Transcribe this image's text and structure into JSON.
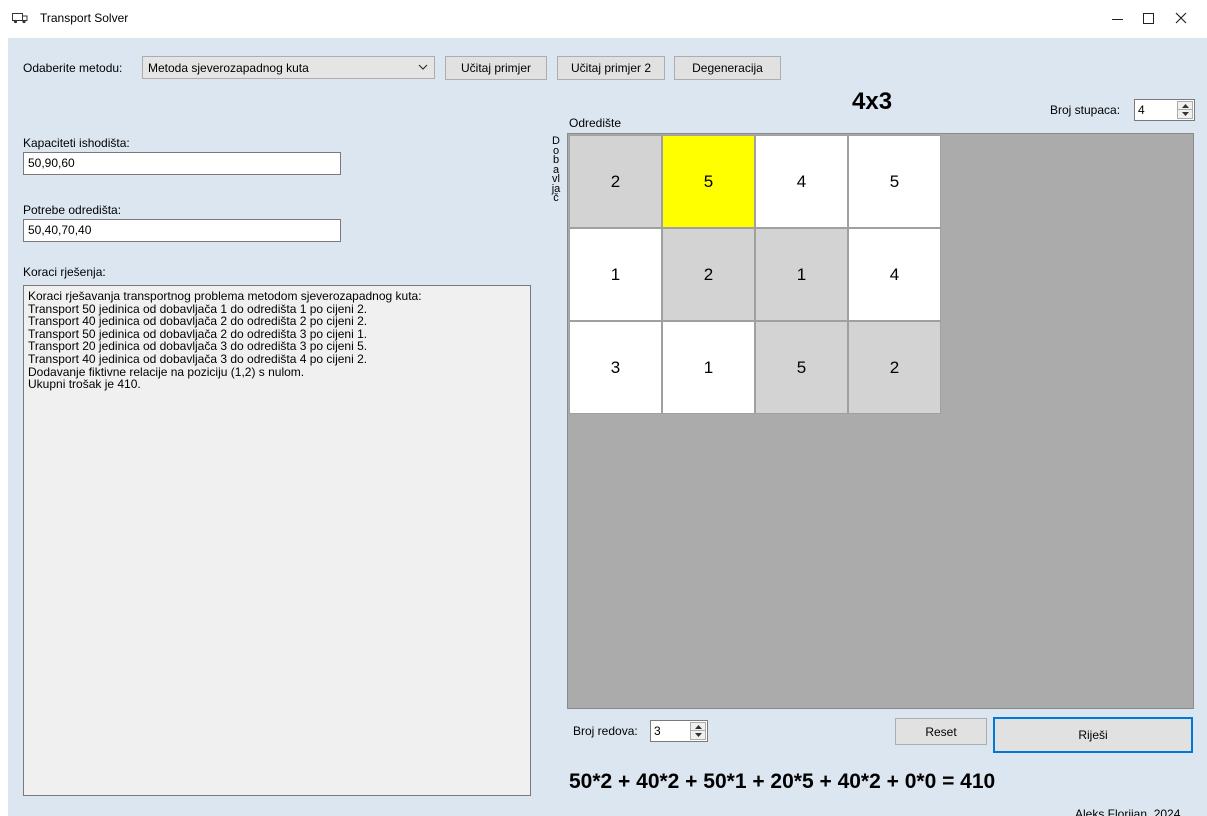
{
  "window": {
    "title": "Transport Solver",
    "icon": "truck-icon",
    "controls": {
      "minimize": "minimize-icon",
      "maximize": "maximize-icon",
      "close": "close-icon"
    }
  },
  "toolbar": {
    "method_label": "Odaberite metodu:",
    "method_selected": "Metoda sjeverozapadnog kuta",
    "load_example_1": "Učitaj primjer",
    "load_example_2": "Učitaj primjer 2",
    "degeneracy": "Degeneracija"
  },
  "inputs": {
    "capacities_label": "Kapaciteti ishodišta:",
    "capacities_value": "50,90,60",
    "demands_label": "Potrebe odredišta:",
    "demands_value": "50,40,70,40"
  },
  "steps": {
    "label": "Koraci rješenja:",
    "lines": [
      "Koraci rješavanja transportnog problema metodom sjeverozapadnog kuta:",
      "Transport 50 jedinica od dobavljača 1 do odredišta 1 po cijeni 2.",
      "Transport 40 jedinica od dobavljača 2 do odredišta 2 po cijeni 2.",
      "Transport 50 jedinica od dobavljača 2 do odredišta 3 po cijeni 1.",
      "Transport 20 jedinica od dobavljača 3 do odredišta 3 po cijeni 5.",
      "Transport 40 jedinica od dobavljača 3 do odredišta 4 po cijeni 2.",
      "Dodavanje fiktivne relacije na poziciju (1,2) s nulom.",
      "Ukupni trošak je 410."
    ]
  },
  "matrix": {
    "dimension_title": "4x3",
    "columns_label": "Broj stupaca:",
    "columns_value": "4",
    "rows_label": "Broj redova:",
    "rows_value": "3",
    "destination_label": "Odredište",
    "supplier_label": "Dobavljač",
    "colors": {
      "allocated": "#d3d3d3",
      "degenerate": "#ffff00",
      "empty": "#ffffff",
      "background": "#ababab"
    },
    "cells": [
      [
        {
          "value": "2",
          "state": "allocated"
        },
        {
          "value": "5",
          "state": "degenerate"
        },
        {
          "value": "4",
          "state": "empty"
        },
        {
          "value": "5",
          "state": "empty"
        }
      ],
      [
        {
          "value": "1",
          "state": "empty"
        },
        {
          "value": "2",
          "state": "allocated"
        },
        {
          "value": "1",
          "state": "allocated"
        },
        {
          "value": "4",
          "state": "empty"
        }
      ],
      [
        {
          "value": "3",
          "state": "empty"
        },
        {
          "value": "1",
          "state": "empty"
        },
        {
          "value": "5",
          "state": "allocated"
        },
        {
          "value": "2",
          "state": "allocated"
        }
      ]
    ]
  },
  "actions": {
    "reset_label": "Reset",
    "solve_label": "Riješi"
  },
  "result": {
    "formula": "50*2 + 40*2 + 50*1 + 20*5 + 40*2 + 0*0 = 410"
  },
  "footer": {
    "author": "Aleks Florijan, 2024."
  }
}
